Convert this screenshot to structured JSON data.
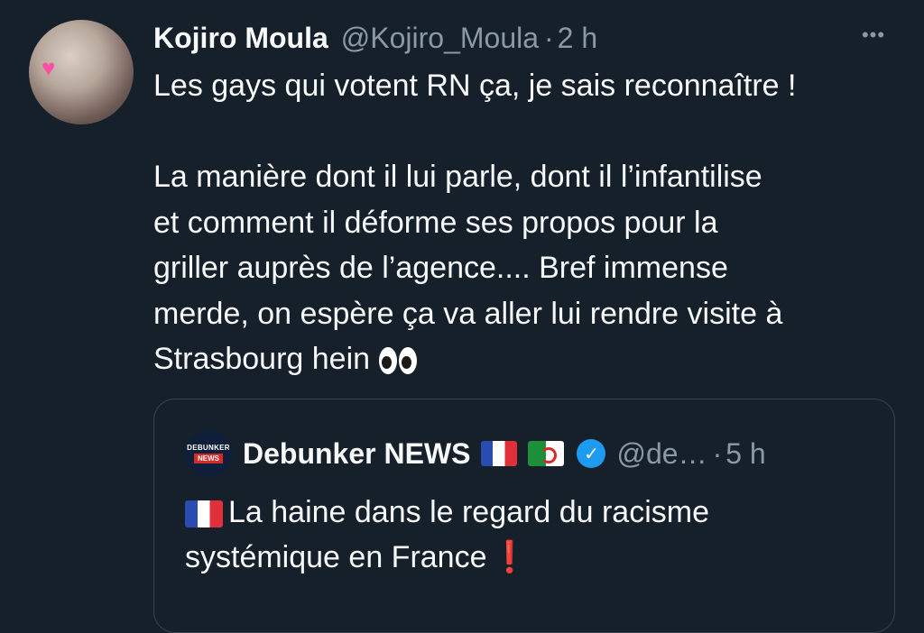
{
  "tweet": {
    "author_name": "Kojiro Moula",
    "handle": "@Kojiro_Moula",
    "separator": "·",
    "time": "2 h",
    "more_label": "•••",
    "lines": [
      "Les gays qui votent RN ça, je sais reconnaître !",
      "",
      "La manière dont il lui parle, dont il l’infantilise",
      "et comment il déforme ses propos pour la",
      "griller auprès de l’agence.... Bref immense",
      "merde, on espère ça va aller lui rendre visite à",
      "Strasbourg hein"
    ]
  },
  "quote": {
    "avatar_text_top": "DEBUNKER",
    "avatar_text_bottom": "NEWS",
    "author_name": "Debunker NEWS",
    "verified_mark": "✓",
    "handle": "@de…",
    "separator": "·",
    "time": "5 h",
    "text_line1": "La haine dans le regard du racisme",
    "text_line2": "systémique en France",
    "exclamation": "❗"
  },
  "colors": {
    "background": "#15202b",
    "text": "#f7f9f9",
    "secondary": "#8b98a5",
    "border": "#38444d",
    "verified": "#1d9bf0"
  }
}
